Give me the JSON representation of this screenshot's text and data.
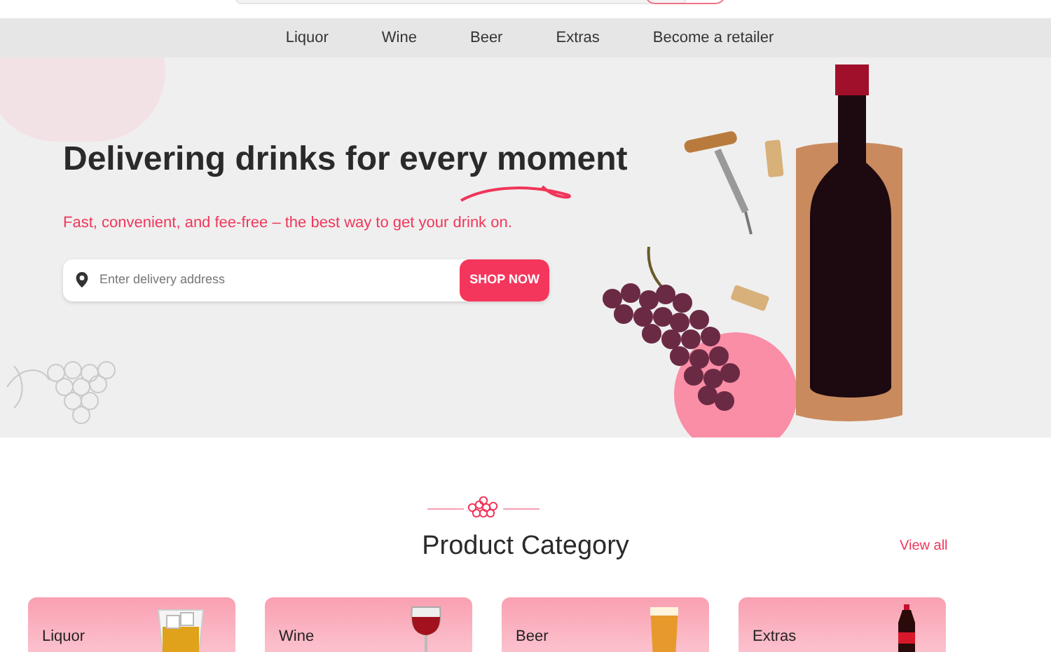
{
  "nav": {
    "items": [
      "Liquor",
      "Wine",
      "Beer",
      "Extras",
      "Become a retailer"
    ]
  },
  "hero": {
    "title": "Delivering drinks for every moment",
    "subtitle": "Fast, convenient, and fee-free – the best way to get your drink on.",
    "search": {
      "placeholder": "Enter delivery address"
    },
    "button": "SHOP NOW"
  },
  "category": {
    "title": "Product Category",
    "view_all": "View all",
    "cards": [
      {
        "label": "Liquor",
        "kind": "liquor"
      },
      {
        "label": "Wine",
        "kind": "wine"
      },
      {
        "label": "Beer",
        "kind": "beer"
      },
      {
        "label": "Extras",
        "kind": "soda"
      }
    ]
  }
}
